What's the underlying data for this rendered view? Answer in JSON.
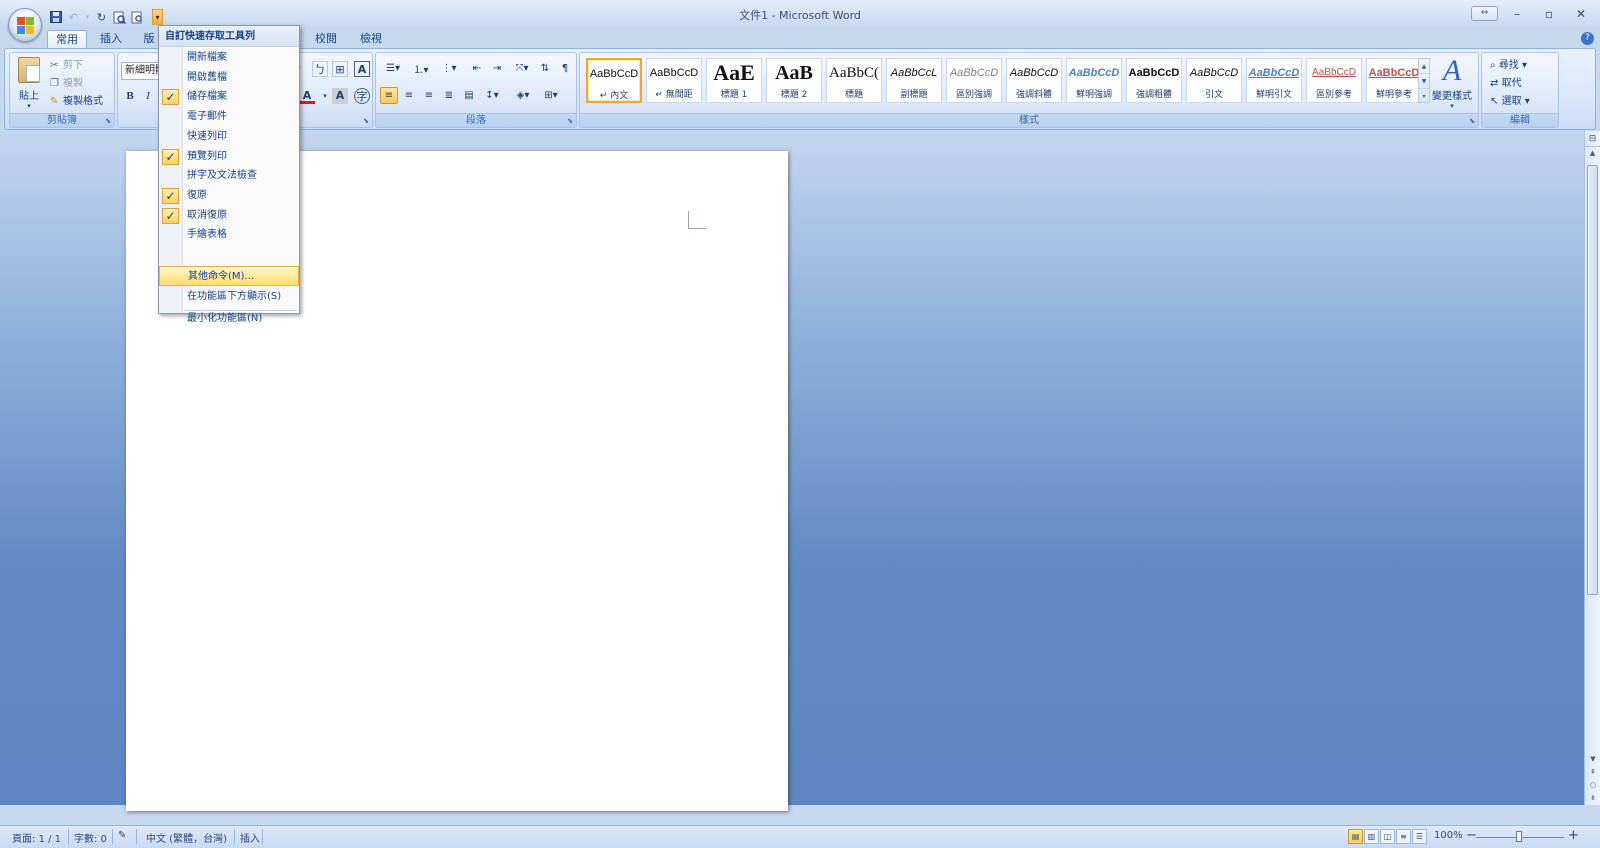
{
  "window": {
    "title": "文件1 - Microsoft Word",
    "minimize": "–",
    "maximize": "▫",
    "close": "✕",
    "restore_icon": "⇔"
  },
  "tabs": [
    {
      "label": "常用"
    },
    {
      "label": "插入"
    },
    {
      "label": "版"
    },
    {
      "label": "校閱"
    },
    {
      "label": "檢視"
    }
  ],
  "clipboard": {
    "paste": "貼上",
    "cut": "剪下",
    "copy": "複製",
    "format_painter": "複製格式",
    "group_label": "剪貼簿"
  },
  "font": {
    "name": "新細明體",
    "bold": "B",
    "italic": "I",
    "font_color": "A"
  },
  "paragraph": {
    "group_label": "段落"
  },
  "styles": {
    "group_label": "樣式",
    "items": [
      {
        "preview": "AaBbCcD",
        "name": "↵ 內文"
      },
      {
        "preview": "AaBbCcD",
        "name": "↵ 無間距"
      },
      {
        "preview": "AaE",
        "name": "標題 1"
      },
      {
        "preview": "AaB",
        "name": "標題 2"
      },
      {
        "preview": "AaBbC(",
        "name": "標題"
      },
      {
        "preview": "AaBbCcL",
        "name": "副標題"
      },
      {
        "preview": "AaBbCcD",
        "name": "區別強調"
      },
      {
        "preview": "AaBbCcD",
        "name": "強調斜體"
      },
      {
        "preview": "AaBbCcD",
        "name": "鮮明強調"
      },
      {
        "preview": "AaBbCcD",
        "name": "強調粗體"
      },
      {
        "preview": "AaBbCcD",
        "name": "引文"
      },
      {
        "preview": "AaBbCcD",
        "name": "鮮明引文"
      },
      {
        "preview": "AaBbCcD",
        "name": "區別參考"
      },
      {
        "preview": "AaBbCcD",
        "name": "鮮明參考"
      }
    ],
    "change_styles": "變更樣式"
  },
  "editing": {
    "find": "尋找",
    "replace": "取代",
    "select": "選取",
    "group_label": "編輯"
  },
  "qat_menu": {
    "title": "自訂快速存取工具列",
    "items": [
      {
        "label": "開新檔案",
        "checked": false
      },
      {
        "label": "開啟舊檔",
        "checked": false
      },
      {
        "label": "儲存檔案",
        "checked": true
      },
      {
        "label": "電子郵件",
        "checked": false
      },
      {
        "label": "快速列印",
        "checked": false
      },
      {
        "label": "預覽列印",
        "checked": true
      },
      {
        "label": "拼字及文法檢查",
        "checked": false
      },
      {
        "label": "復原",
        "checked": true
      },
      {
        "label": "取消復原",
        "checked": true
      },
      {
        "label": "手繪表格",
        "checked": false
      }
    ],
    "more_commands": "其他命令(M)...",
    "show_below": "在功能區下方顯示(S)",
    "minimize_ribbon": "最小化功能區(N)",
    "check_mark": "✓"
  },
  "status": {
    "page": "頁面: 1 / 1",
    "words": "字數: 0",
    "language": "中文 (繁體，台灣)",
    "mode": "插入",
    "zoom": "100%",
    "zoom_out": "−",
    "zoom_in": "+"
  },
  "colors": {
    "accent": "#15428b",
    "highlight": "#ffd35c",
    "workspace": "#5d86c2"
  }
}
